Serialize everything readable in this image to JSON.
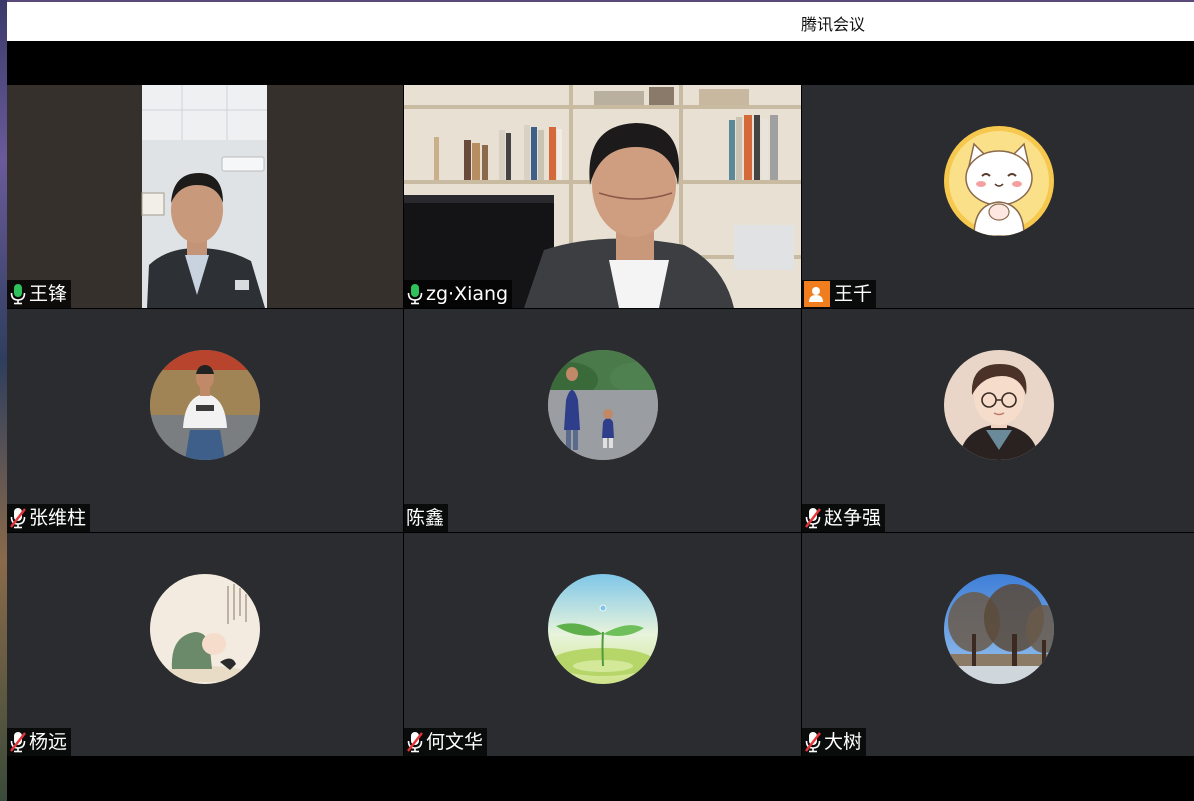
{
  "window": {
    "title": "腾讯会议"
  },
  "participants": [
    {
      "name": "王锋",
      "mic": "on",
      "view": "video"
    },
    {
      "name": "zg·Xiang",
      "mic": "on",
      "view": "video"
    },
    {
      "name": "王千",
      "mic": "none",
      "view": "avatar",
      "badge": "user-placeholder-icon"
    },
    {
      "name": "张维柱",
      "mic": "muted",
      "view": "avatar"
    },
    {
      "name": "陈鑫",
      "mic": "none",
      "view": "avatar"
    },
    {
      "name": "赵争强",
      "mic": "muted",
      "view": "avatar"
    },
    {
      "name": "杨远",
      "mic": "muted",
      "view": "avatar"
    },
    {
      "name": "何文华",
      "mic": "muted",
      "view": "avatar"
    },
    {
      "name": "大树",
      "mic": "muted",
      "view": "avatar"
    }
  ],
  "colors": {
    "tile_bg": "#2b2c2f",
    "active_speaker_border": "#2fc15a",
    "mic_on": "#2fc15a",
    "mic_muted_slash": "#e5343a",
    "placeholder_badge": "#f07e1e"
  }
}
